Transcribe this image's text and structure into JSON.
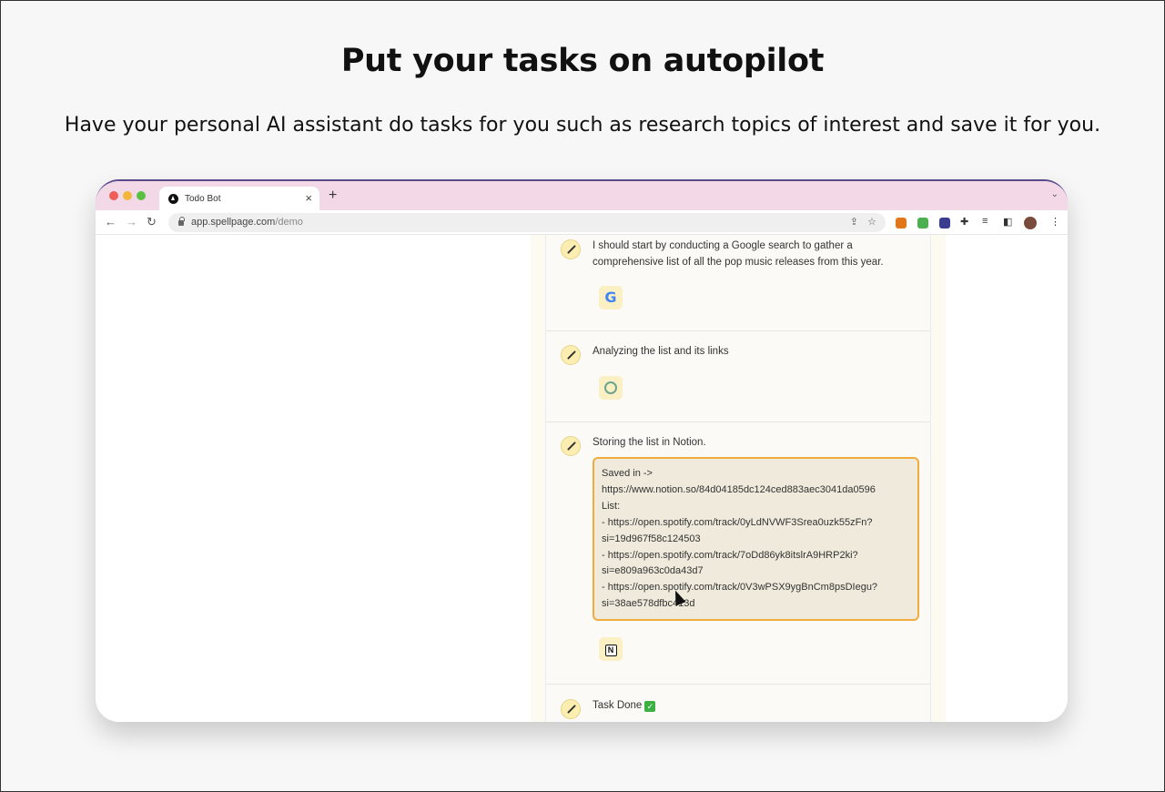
{
  "hero": {
    "title": "Put your tasks on autopilot",
    "subtitle": "Have your personal AI assistant do tasks for you such as research topics of interest and save it for you."
  },
  "browser": {
    "tab_title": "Todo Bot",
    "tab_close": "×",
    "new_tab": "+",
    "url_host": "app.spellpage.com",
    "url_path": "/demo"
  },
  "steps": [
    {
      "text_line1": "I should start by conducting a Google search to gather a",
      "text_line2": "comprehensive list of all the pop music releases from this year.",
      "tool_icon": "google-icon"
    },
    {
      "text": "Analyzing the list and its links",
      "tool_icon": "openai-icon"
    },
    {
      "text": "Storing the list in Notion.",
      "tool_icon": "notion-icon",
      "saved_box": [
        "Saved in ->",
        "https://www.notion.so/84d04185dc124ced883aec3041da0596",
        "List:",
        "- https://open.spotify.com/track/0yLdNVWF3Srea0uzk55zFn?",
        "si=19d967f58c124503",
        "- https://open.spotify.com/track/7oDd86yk8itslrA9HRP2ki?",
        "si=e809a963c0da43d7",
        "- https://open.spotify.com/track/0V3wPSX9ygBnCm8psDIegu?",
        "si=38ae578dfbc413d"
      ]
    },
    {
      "text": "Task Done",
      "done_mark": "✓"
    }
  ],
  "colors": {
    "tab_bar": "#f3d9e8",
    "saved_border": "#f0ad3e",
    "saved_bg": "#efeadc"
  }
}
